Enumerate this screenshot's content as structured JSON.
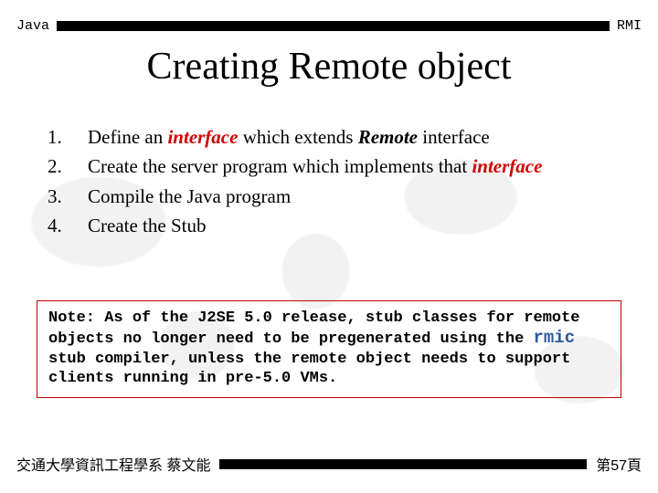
{
  "header": {
    "left": "Java",
    "right": "RMI"
  },
  "title": "Creating Remote object",
  "list": [
    {
      "num": "1.",
      "parts": [
        {
          "t": "Define an "
        },
        {
          "t": "interface",
          "cls": "bi-red"
        },
        {
          "t": " which extends "
        },
        {
          "t": "Remote",
          "cls": "bi"
        },
        {
          "t": " interface"
        }
      ]
    },
    {
      "num": "2.",
      "parts": [
        {
          "t": "Create the server program which  implements that "
        },
        {
          "t": "interface",
          "cls": "bi-red"
        }
      ]
    },
    {
      "num": "3.",
      "parts": [
        {
          "t": "Compile the Java program"
        }
      ]
    },
    {
      "num": "4.",
      "parts": [
        {
          "t": "Create the Stub"
        }
      ]
    }
  ],
  "note": {
    "pre": "Note: As of the J2SE 5.0 release, stub classes for remote objects no longer need to be pregenerated using the ",
    "code": "rmic",
    "post": " stub compiler, unless the remote object needs to support clients running in pre-5.0 VMs."
  },
  "footer": {
    "left": "交通大學資訊工程學系 蔡文能",
    "right": "第57頁"
  }
}
